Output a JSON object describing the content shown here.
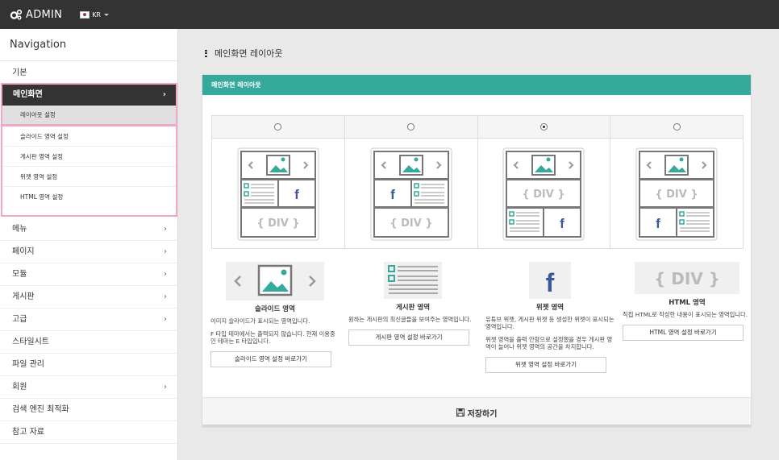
{
  "app": {
    "brand": "ADMIN",
    "brand_icon": "cogs-icon",
    "language": "KR",
    "language_icon": "korea-flag-icon"
  },
  "sidebar": {
    "title": "Navigation",
    "items_before": [
      {
        "label": "기본",
        "has_submenu": false
      }
    ],
    "active": {
      "label": "메인화면",
      "subitems": [
        {
          "label": "레이아웃 설정",
          "selected": true
        },
        {
          "label": "슬라이드 영역 설정",
          "selected": false
        },
        {
          "label": "게시판 영역 설정",
          "selected": false
        },
        {
          "label": "위젯 영역 설정",
          "selected": false
        },
        {
          "label": "HTML 영역 설정",
          "selected": false
        }
      ]
    },
    "items_after": [
      {
        "label": "메뉴",
        "has_submenu": true
      },
      {
        "label": "페이지",
        "has_submenu": true
      },
      {
        "label": "모듈",
        "has_submenu": true
      },
      {
        "label": "게시판",
        "has_submenu": true
      },
      {
        "label": "고급",
        "has_submenu": true
      },
      {
        "label": "스타일시트",
        "has_submenu": false
      },
      {
        "label": "파일 관리",
        "has_submenu": false
      },
      {
        "label": "회원",
        "has_submenu": true
      },
      {
        "label": "검색 엔진 최적화",
        "has_submenu": false
      },
      {
        "label": "참고 자료",
        "has_submenu": false
      }
    ]
  },
  "main": {
    "page_title": "메인화면 레이아웃",
    "panel_title": "메인화면 레이아웃",
    "accent_color": "#35a99b",
    "layout_options": [
      {
        "variant": "slide / board + widget / div",
        "selected": false
      },
      {
        "variant": "slide / widget + board / div",
        "selected": false
      },
      {
        "variant": "slide / div / board + widget",
        "selected": true
      },
      {
        "variant": "slide / div / widget + board",
        "selected": false
      }
    ],
    "div_label": "{ DIV }",
    "cards": [
      {
        "icon": "image-slider-icon",
        "title": "슬라이드 영역",
        "desc": [
          "이미지 슬라이드가 표시되는 영역입니다.",
          "F 타입 테마에서는 출력되지 않습니다. 현재 이용중인 테마는 E 타입입니다."
        ],
        "button": "슬라이드 영역 설정 바로가기"
      },
      {
        "icon": "board-list-icon",
        "title": "게시판 영역",
        "desc": [
          "원하는 게시판의 최신글들을 보여주는 영역입니다."
        ],
        "button": "게시판 영역 설정 바로가기"
      },
      {
        "icon": "facebook-icon",
        "title": "위젯 영역",
        "desc": [
          "유튜브 위젯, 게시판 위젯 등 생성한 위젯이 표시되는 영역입니다.",
          "위젯 영역을 출력 안함으로 설정했을 경우 게시판 영역이 늘어나 위젯 영역의 공간을 차지합니다."
        ],
        "button": "위젯 영역 설정 바로가기"
      },
      {
        "icon": "div-block-icon",
        "title": "HTML 영역",
        "desc": [
          "직접 HTML로 작성한 내용이 표시되는 영역입니다."
        ],
        "button": "HTML 영역 설정 바로가기"
      }
    ],
    "save_label": "저장하기",
    "save_icon": "floppy-disk-icon"
  }
}
